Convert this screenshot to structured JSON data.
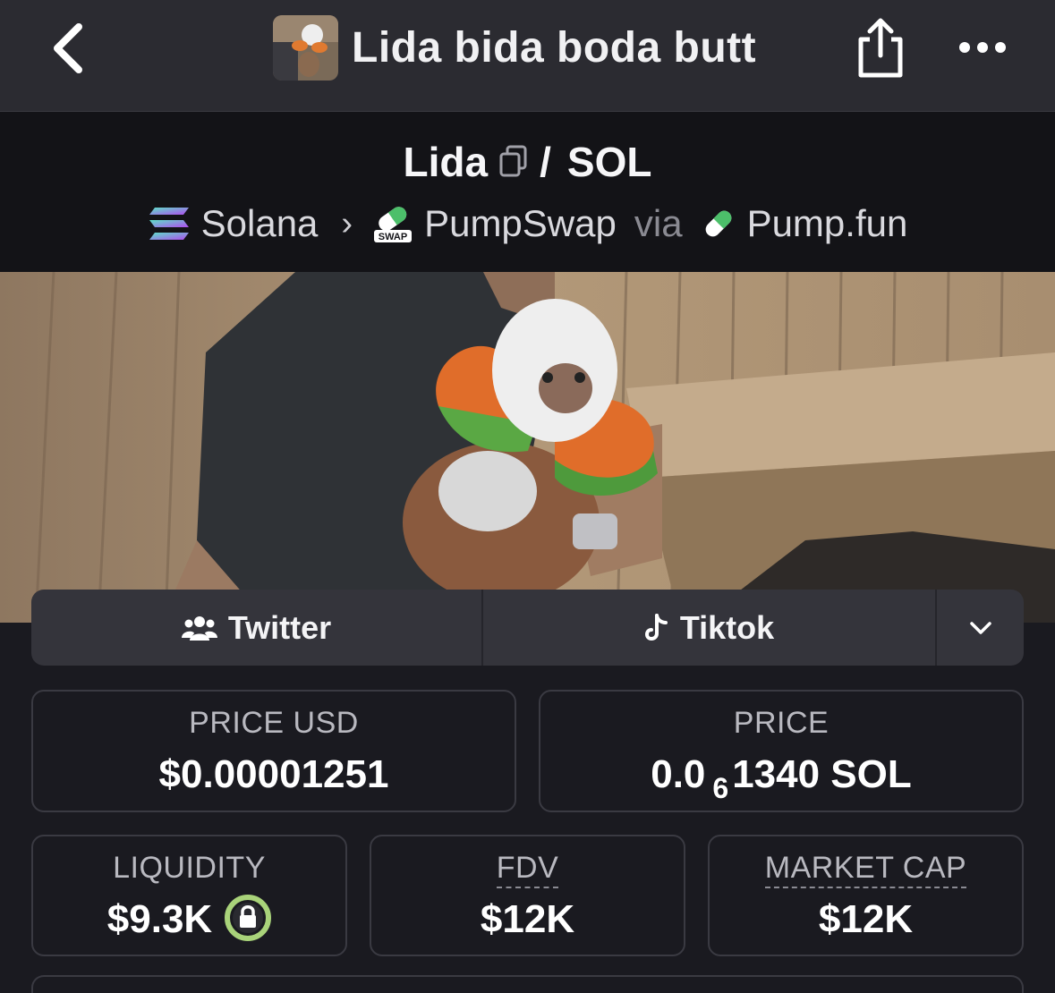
{
  "nav": {
    "title": "Lida bida boda butt",
    "icons": [
      "chevron-left-icon",
      "token-avatar",
      "share-icon",
      "more-dots-icon"
    ]
  },
  "pair": {
    "base": "Lida",
    "separator": "/",
    "quote": "SOL",
    "chain": "Solana",
    "dex": "PumpSwap",
    "dex_badge": "SWAP",
    "via": "via",
    "launchpad": "Pump.fun"
  },
  "social": {
    "twitter": "Twitter",
    "tiktok": "Tiktok"
  },
  "stats": {
    "price_usd": {
      "label": "PRICE USD",
      "value": "$0.00001251"
    },
    "price": {
      "label": "PRICE",
      "prefix": "0.0",
      "zeros": "6",
      "suffix": "1340 SOL"
    },
    "liquidity": {
      "label": "LIQUIDITY",
      "value": "$9.3K"
    },
    "fdv": {
      "label": "FDV",
      "value": "$12K"
    },
    "market_cap": {
      "label": "MARKET CAP",
      "value": "$12K"
    }
  },
  "colors": {
    "nav_bg": "#2b2b31",
    "header_bg": "#131317",
    "page_bg": "#1a1a20",
    "lock_green": "#a9d37a"
  }
}
